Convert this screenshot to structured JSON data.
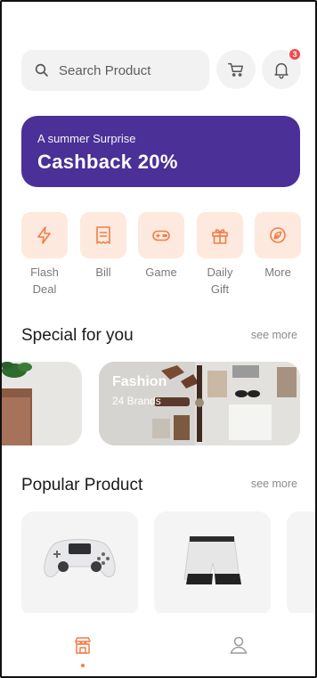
{
  "search": {
    "placeholder": "Search Product"
  },
  "header": {
    "cart_icon": "cart-icon",
    "bell_icon": "bell-icon",
    "notification_count": "3"
  },
  "banner": {
    "subtitle": "A summer Surprise",
    "title": "Cashback 20%",
    "color": "#4a3097"
  },
  "categories": [
    {
      "label": "Flash\nDeal",
      "icon": "lightning-icon"
    },
    {
      "label": "Bill",
      "icon": "bill-icon"
    },
    {
      "label": "Game",
      "icon": "gamepad-icon"
    },
    {
      "label": "Daily\nGift",
      "icon": "gift-icon"
    },
    {
      "label": "More",
      "icon": "more-icon"
    }
  ],
  "special": {
    "title": "Special for you",
    "see_more": "see more",
    "cards": [
      {
        "name": "",
        "brands": ""
      },
      {
        "name": "Fashion",
        "brands": "24 Brands"
      }
    ]
  },
  "popular": {
    "title": "Popular Product",
    "see_more": "see more",
    "products": [
      {
        "icon": "gamepad-controller-image"
      },
      {
        "icon": "shorts-image"
      },
      {
        "icon": "product-image"
      }
    ]
  },
  "bottom_nav": {
    "items": [
      {
        "icon": "shop-icon",
        "active": true
      },
      {
        "icon": "user-icon",
        "active": false
      }
    ]
  },
  "colors": {
    "accent": "#f27d49",
    "tile_bg": "#fde9dd",
    "badge": "#f5484a"
  }
}
